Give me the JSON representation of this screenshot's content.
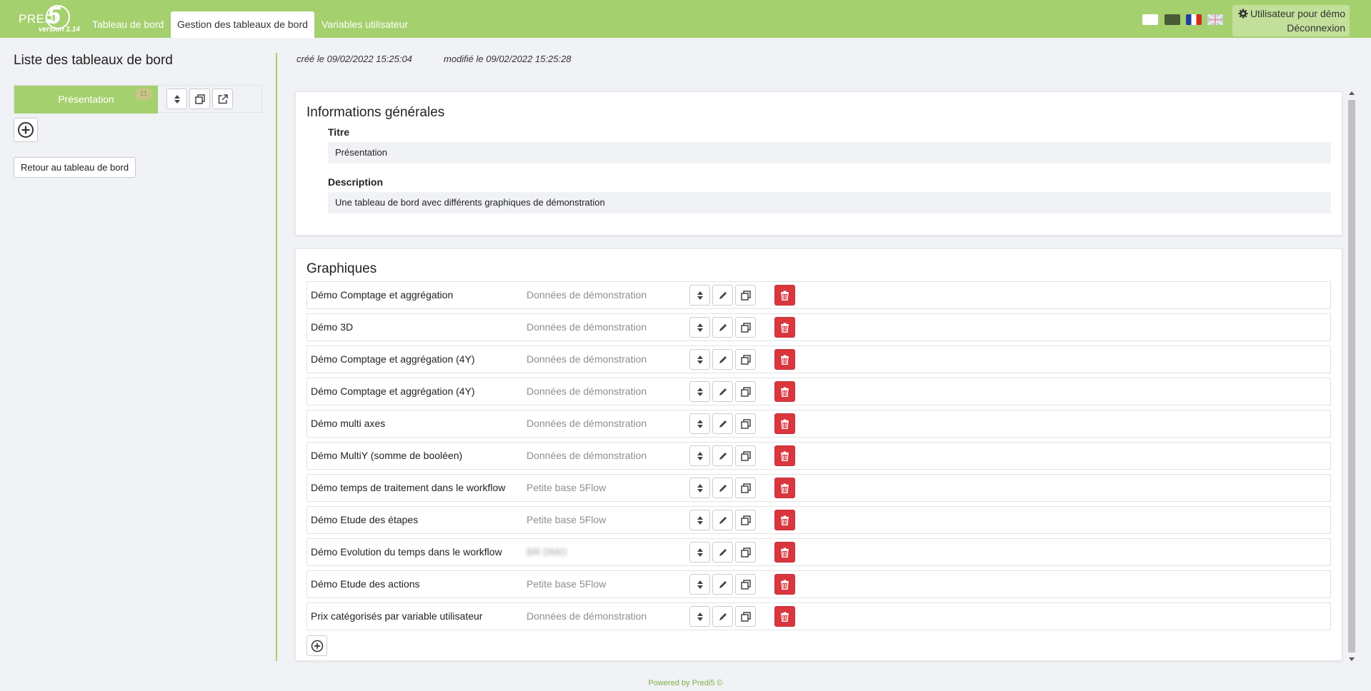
{
  "brand": {
    "name": "PREDI",
    "number": "5",
    "version": "version 1.14"
  },
  "nav": {
    "tabs": [
      {
        "label": "Tableau de bord"
      },
      {
        "label": "Gestion des tableaux de bord"
      },
      {
        "label": "Variables utilisateur"
      }
    ]
  },
  "user": {
    "name": "Utilisateur pour démo",
    "logout_label": "Déconnexion"
  },
  "sidebar": {
    "title": "Liste des tableaux de bord",
    "dashboards": [
      {
        "label": "Présentation",
        "badge": "11"
      }
    ],
    "back_label": "Retour au tableau de bord"
  },
  "meta": {
    "created": "créé le 09/02/2022 15:25:04",
    "modified": "modifié le 09/02/2022 15:25:28"
  },
  "info_panel": {
    "heading": "Informations générales",
    "title_label": "Titre",
    "title_value": "Présentation",
    "description_label": "Description",
    "description_value": "Une tableau de bord avec différents graphiques de démonstration"
  },
  "charts_panel": {
    "heading": "Graphiques",
    "rows": [
      {
        "name": "Démo Comptage et aggrégation",
        "source": "Données de démonstration"
      },
      {
        "name": "Démo 3D",
        "source": "Données de démonstration"
      },
      {
        "name": "Démo Comptage et aggrégation (4Y)",
        "source": "Données de démonstration"
      },
      {
        "name": "Démo Comptage et aggrégation (4Y)",
        "source": "Données de démonstration"
      },
      {
        "name": "Démo multi axes",
        "source": "Données de démonstration"
      },
      {
        "name": "Démo MultiY (somme de booléen)",
        "source": "Données de démonstration"
      },
      {
        "name": "Démo temps de traitement dans le workflow",
        "source": "Petite base 5Flow"
      },
      {
        "name": "Démo Etude des étapes",
        "source": "Petite base 5Flow"
      },
      {
        "name": "Démo Evolution du temps dans le workflow",
        "source": "BR DMO"
      },
      {
        "name": "Démo Etude des actions",
        "source": "Petite base 5Flow"
      },
      {
        "name": "Prix catégorisés par variable utilisateur",
        "source": "Données de démonstration"
      }
    ]
  },
  "footer": "Powered by Predi5 ©",
  "colors": {
    "accent": "#a5d06e",
    "delete": "#d9363e",
    "background": "#f0f2f5"
  },
  "icons": {
    "move": "sort-arrows-icon",
    "edit": "pencil-icon",
    "copy": "duplicate-icon",
    "delete": "trash-icon",
    "add": "plus-circle-icon",
    "open": "external-link-icon",
    "settings": "gear-icon"
  }
}
